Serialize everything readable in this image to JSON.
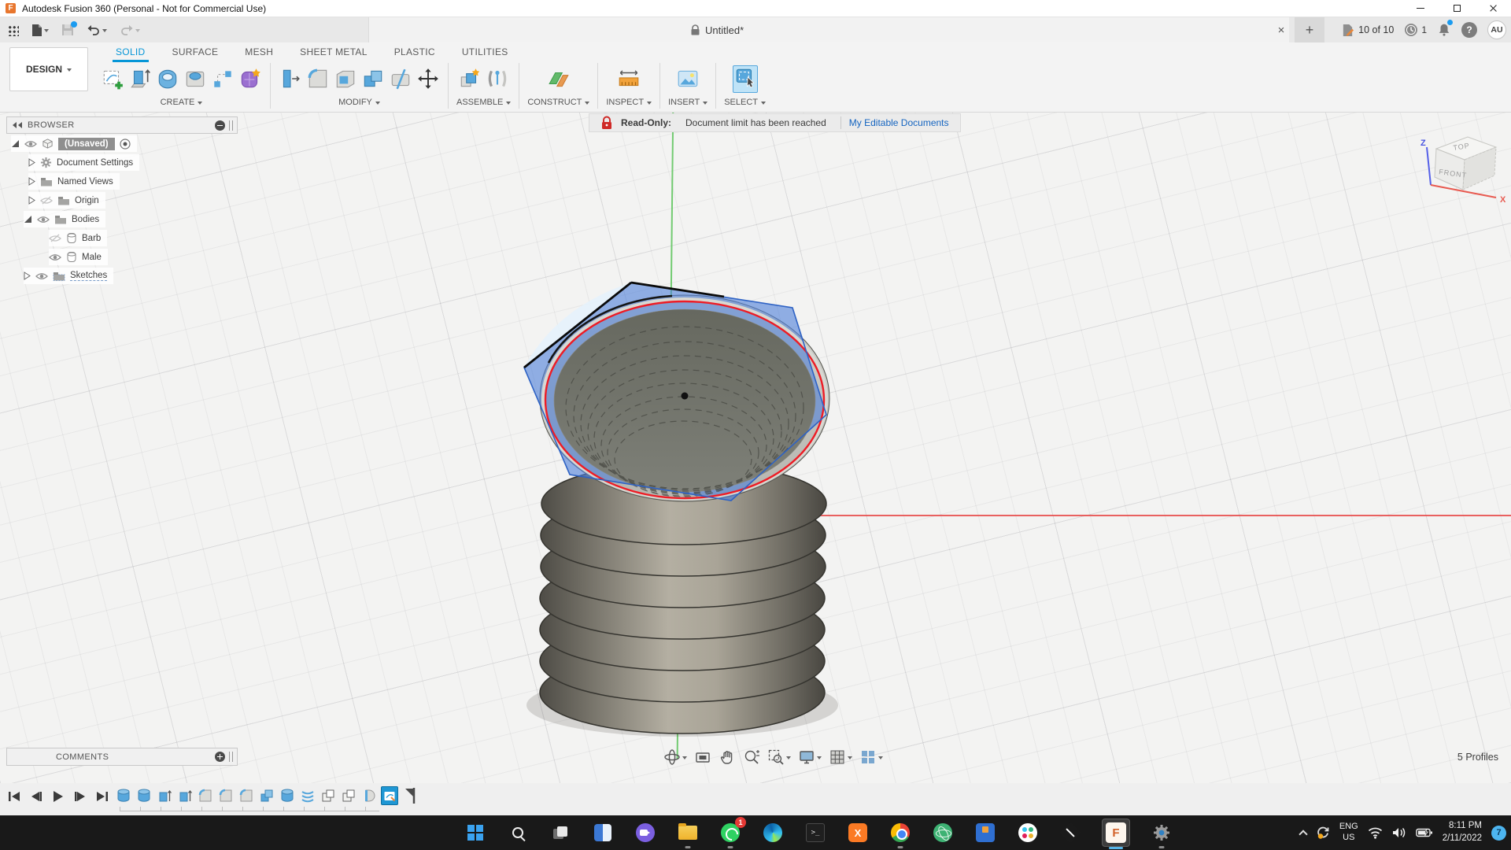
{
  "window": {
    "title": "Autodesk Fusion 360 (Personal - Not for Commercial Use)"
  },
  "document_tab": {
    "title": "Untitled*"
  },
  "status": {
    "pages": "10 of 10",
    "history_badge": "1",
    "avatar": "AU",
    "help_glyph": "?",
    "tab_close_glyph": "×",
    "tab_new_glyph": "+"
  },
  "ribbon": {
    "design_label": "DESIGN",
    "tabs": [
      {
        "label": "SOLID",
        "active": true
      },
      {
        "label": "SURFACE",
        "active": false
      },
      {
        "label": "MESH",
        "active": false
      },
      {
        "label": "SHEET METAL",
        "active": false
      },
      {
        "label": "PLASTIC",
        "active": false
      },
      {
        "label": "UTILITIES",
        "active": false
      }
    ],
    "groups": [
      {
        "label": "CREATE"
      },
      {
        "label": "MODIFY"
      },
      {
        "label": "ASSEMBLE"
      },
      {
        "label": "CONSTRUCT"
      },
      {
        "label": "INSPECT"
      },
      {
        "label": "INSERT"
      },
      {
        "label": "SELECT"
      }
    ],
    "create_icons": [
      "create-sketch",
      "extrude",
      "revolve",
      "hole",
      "sketch-dimension",
      "form"
    ],
    "modify_icons": [
      "press-pull",
      "fillet",
      "shell",
      "combine",
      "split-body",
      "move"
    ],
    "assemble_icons": [
      "new-component",
      "joint"
    ],
    "construct_icons": [
      "construct-plane"
    ],
    "inspect_icons": [
      "measure"
    ],
    "insert_icons": [
      "insert-image"
    ],
    "select_icons": [
      "select"
    ]
  },
  "readonly": {
    "label": "Read-Only:",
    "message": "Document limit has been reached",
    "link": "My Editable Documents"
  },
  "browser": {
    "header": "BROWSER",
    "items": [
      {
        "label": "(Unsaved)",
        "icon": "component",
        "visible": true,
        "highlighted": true
      },
      {
        "label": "Document Settings",
        "icon": "gear",
        "visible": null
      },
      {
        "label": "Named Views",
        "icon": "folder",
        "visible": null
      },
      {
        "label": "Origin",
        "icon": "folder",
        "visible": false
      },
      {
        "label": "Bodies",
        "icon": "folder",
        "visible": true
      },
      {
        "label": "Barb",
        "icon": "body",
        "visible": false
      },
      {
        "label": "Male",
        "icon": "body",
        "visible": true
      },
      {
        "label": "Sketches",
        "icon": "folder",
        "visible": true
      }
    ]
  },
  "viewcube": {
    "top": "TOP",
    "front": "FRONT",
    "axis_z": "Z",
    "axis_x": "X"
  },
  "viewport": {
    "profiles_label": "5 Profiles"
  },
  "comments": {
    "label": "COMMENTS"
  },
  "navbar_icons": [
    "orbit",
    "look-at",
    "pan",
    "zoom",
    "fit",
    "display-settings",
    "grid",
    "viewports"
  ],
  "timeline": {
    "playback_icons": [
      "skip-to-start",
      "step-back",
      "play",
      "step-forward",
      "skip-to-end"
    ],
    "feature_icons": [
      "cylinder",
      "cylinder",
      "extrude",
      "extrude",
      "fillet",
      "fillet",
      "fillet",
      "combine",
      "cylinder",
      "coil",
      "pattern",
      "pattern",
      "revolve",
      "sketch-active"
    ]
  },
  "taskbar": {
    "apps": [
      {
        "name": "start"
      },
      {
        "name": "search"
      },
      {
        "name": "task-view"
      },
      {
        "name": "widgets"
      },
      {
        "name": "chat"
      },
      {
        "name": "file-explorer",
        "running": true
      },
      {
        "name": "whatsapp",
        "running": true,
        "badge": "1"
      },
      {
        "name": "edge"
      },
      {
        "name": "terminal"
      },
      {
        "name": "xampp"
      },
      {
        "name": "chrome",
        "running": true
      },
      {
        "name": "atom"
      },
      {
        "name": "cube-app"
      },
      {
        "name": "slack"
      },
      {
        "name": "inkscape"
      },
      {
        "name": "fusion-360",
        "active": true
      },
      {
        "name": "settings",
        "running": true
      }
    ],
    "terminal_glyph": "&gt;_",
    "xampp_glyph": "X",
    "fusion_glyph": "F",
    "language_line1": "ENG",
    "language_line2": "US",
    "time": "8:11 PM",
    "date": "2/11/2022",
    "notification_count": "7",
    "whatsapp_badge": "1"
  },
  "colors": {
    "accent": "#0696d7",
    "readonly_red": "#cf2a27",
    "link_blue": "#1464c0",
    "sketch_fill_blue": "#4d7ed8",
    "profile_highlight_red": "#ee1c25",
    "taskbar_bg": "#191919"
  }
}
